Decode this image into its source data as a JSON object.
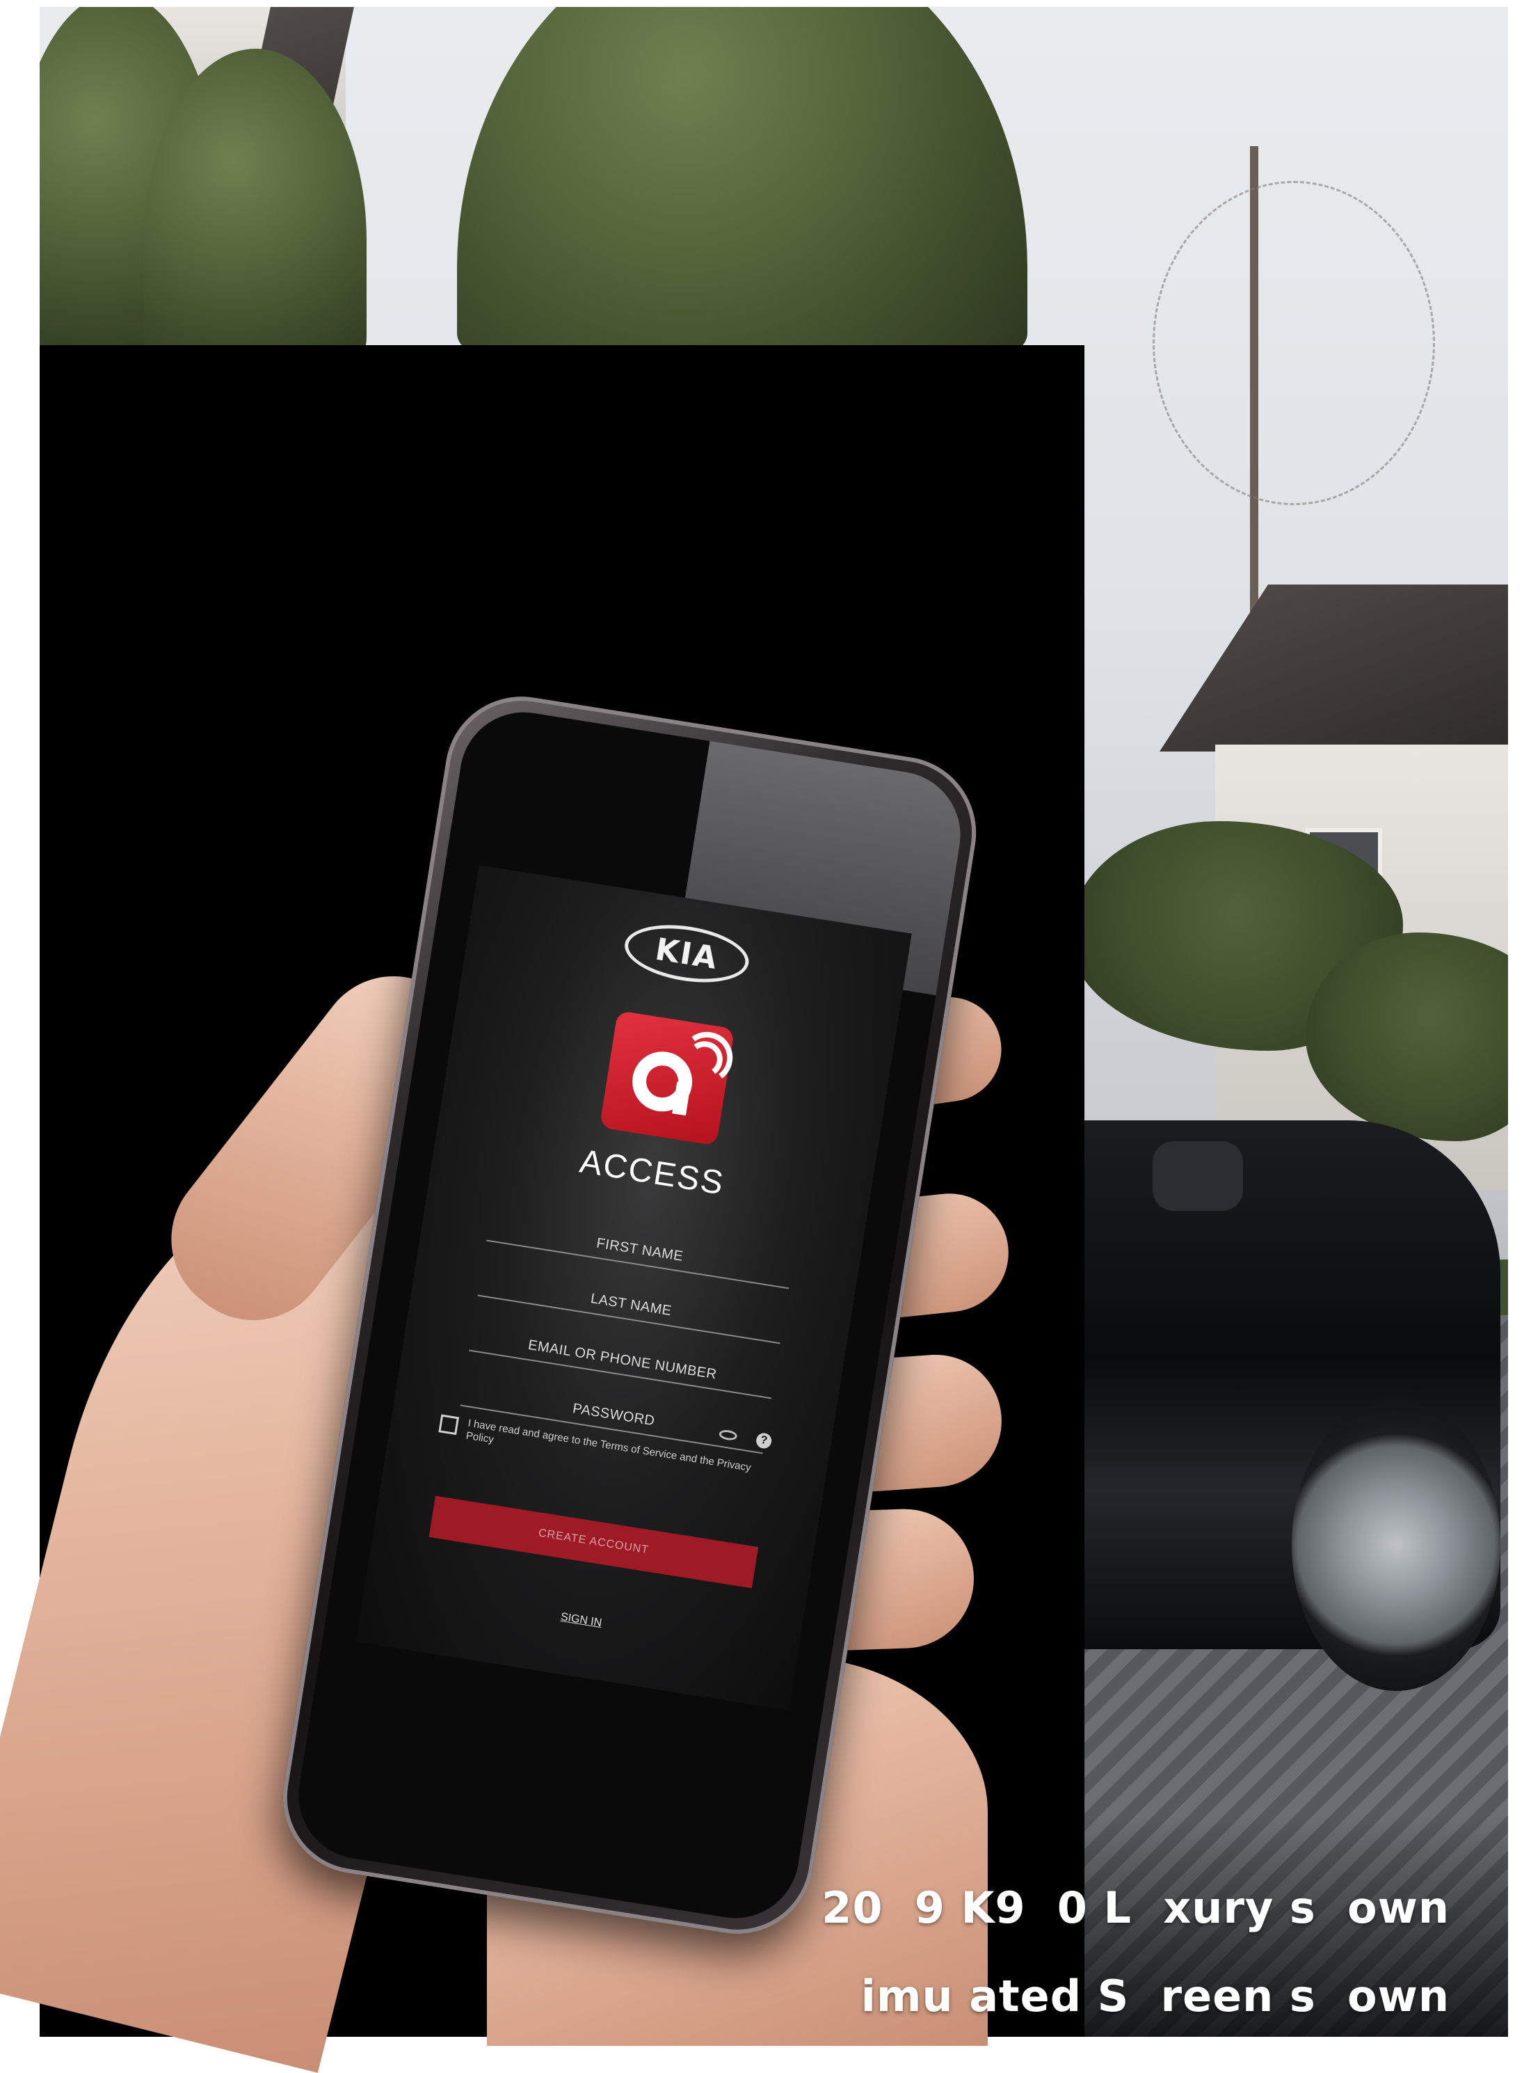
{
  "phone_app": {
    "brand_logo": "KIA",
    "app_name": "ACCESS",
    "fields": {
      "first_name": "FIRST NAME",
      "last_name": "LAST NAME",
      "email_or_phone": "EMAIL OR PHONE NUMBER",
      "password": "PASSWORD"
    },
    "help_glyph": "?",
    "agree_text": "I have read and agree to the Terms of Service and the Privacy Policy",
    "create_account_label": "CREATE ACCOUNT",
    "sign_in_label": "SIGN IN"
  },
  "captions": {
    "line1": "20  9 K9  0 L  xury s  own",
    "line2": "imu ated S  reen s  own"
  },
  "icons": [
    "kia-logo",
    "access-app-icon",
    "eye-icon",
    "help-icon",
    "checkbox-icon"
  ],
  "colors": {
    "accent_red": "#b5121d",
    "button_red": "#9e1b26",
    "panel_black": "#000000",
    "caption_white": "#ffffff"
  }
}
